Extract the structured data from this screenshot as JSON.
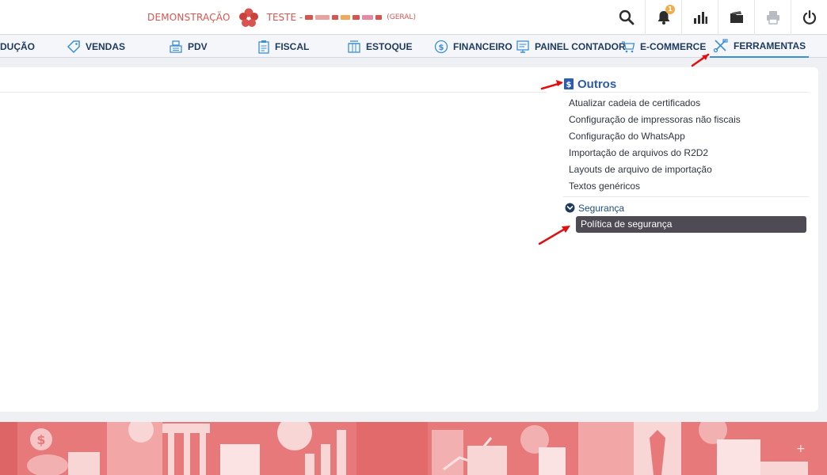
{
  "header": {
    "demo_label": "DEMONSTRAÇÃO",
    "company_label": "TESTE -",
    "scope_label": "(GERAL)",
    "notification_count": "1",
    "actions": [
      {
        "icon": "search-icon"
      },
      {
        "icon": "bell-icon"
      },
      {
        "icon": "chart-icon"
      },
      {
        "icon": "folder-icon"
      },
      {
        "icon": "printer-icon"
      },
      {
        "icon": "power-icon"
      }
    ]
  },
  "nav": {
    "items": [
      {
        "label": "DUÇÃO",
        "icon": ""
      },
      {
        "label": "VENDAS",
        "icon": "tag-icon"
      },
      {
        "label": "PDV",
        "icon": "cash-register-icon"
      },
      {
        "label": "FISCAL",
        "icon": "clipboard-icon"
      },
      {
        "label": "ESTOQUE",
        "icon": "box-icon"
      },
      {
        "label": "FINANCEIRO",
        "icon": "dollar-icon"
      },
      {
        "label": "PAINEL CONTADOR",
        "icon": "monitor-icon"
      },
      {
        "label": "E-COMMERCE",
        "icon": "cart-icon"
      },
      {
        "label": "FERRAMENTAS",
        "icon": "tools-icon"
      }
    ],
    "active": "FERRAMENTAS"
  },
  "menu": {
    "title": "Outros",
    "items": [
      "Atualizar cadeia de certificados",
      "Configuração de impressoras não fiscais",
      "Configuração do WhatsApp",
      "Importação de arquivos do R2D2",
      "Layouts de arquivo de importação",
      "Textos genéricos"
    ],
    "section": {
      "label": "Segurança",
      "items": [
        "Política de segurança"
      ]
    }
  },
  "colors": {
    "accent": "#2a5db0",
    "brand_red": "#d9534f",
    "nav_text": "#1e3a5f",
    "selected_bg": "#4f4b55",
    "footer": "#e7797a"
  }
}
